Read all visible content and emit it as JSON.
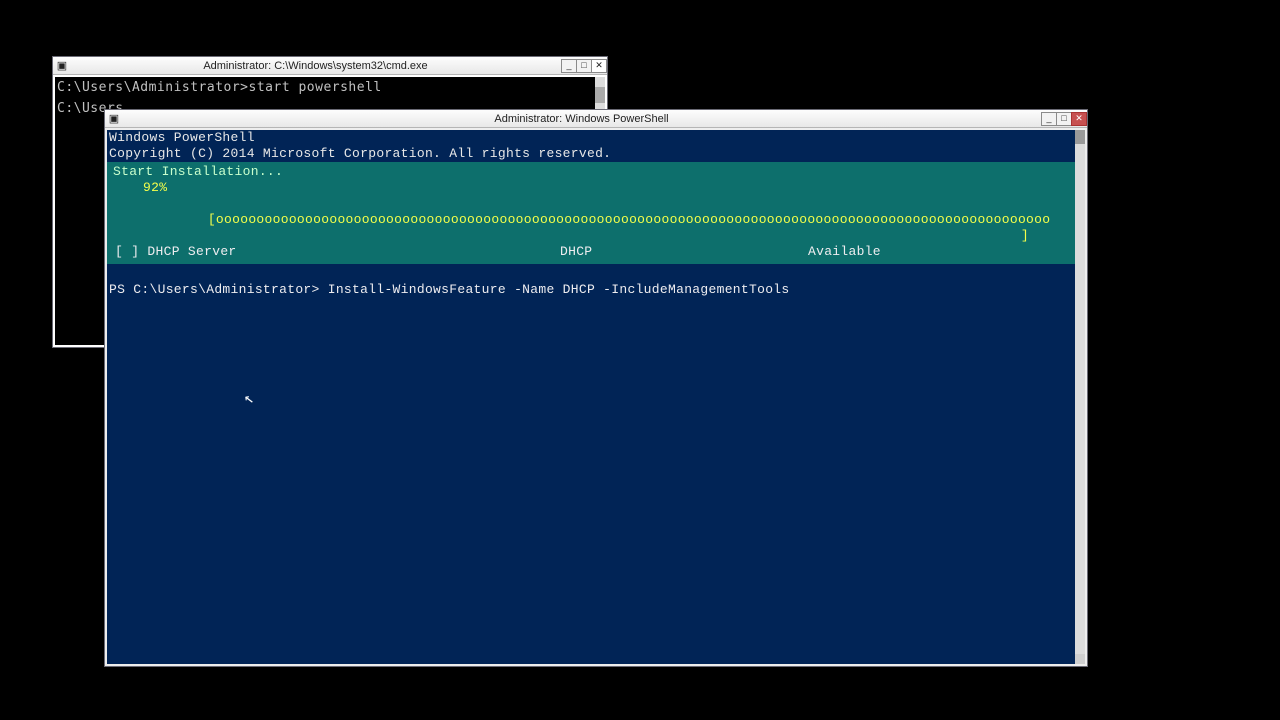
{
  "cmd": {
    "title": "Administrator: C:\\Windows\\system32\\cmd.exe",
    "icon_glyph": "▣",
    "lines": [
      "C:\\Users\\Administrator>start powershell",
      "",
      "C:\\Users"
    ]
  },
  "ps": {
    "title": "Administrator: Windows PowerShell",
    "icon_glyph": "▣",
    "header1": "Windows PowerShell",
    "header2": "Copyright (C) 2014 Microsoft Corporation. All rights reserved.",
    "progress": {
      "title": "Start Installation...",
      "percent_label": "92%",
      "bar_open": "[",
      "bar_fill": "ooooooooooooooooooooooooooooooooooooooooooooooooooooooooooooooooooooooooooooooooooooooooooooooooooooooo",
      "bar_close": "]"
    },
    "feature_row": {
      "col1": "[ ] DHCP Server",
      "col2": "DHCP",
      "col3": "Available"
    },
    "prompt": "PS C:\\Users\\Administrator> Install-WindowsFeature -Name DHCP -IncludeManagementTools"
  },
  "winbtns": {
    "min": "_",
    "max": "□",
    "close": "✕"
  }
}
